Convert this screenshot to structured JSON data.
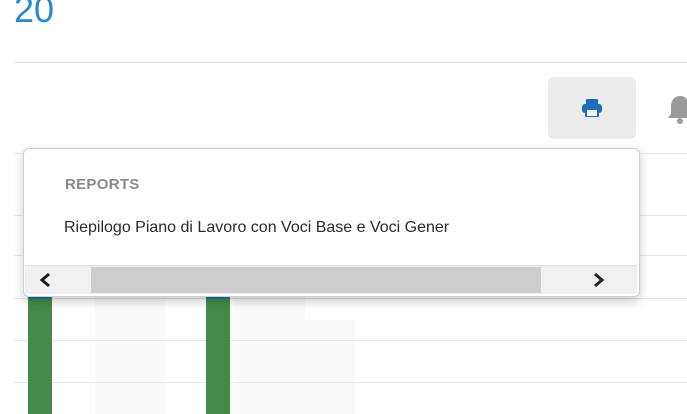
{
  "header": {
    "page_number": "20"
  },
  "toolbar": {
    "print_icon": "printer-icon",
    "bell_icon": "bell-icon",
    "accent_color": "#2c87c7"
  },
  "dropdown": {
    "heading": "REPORTS",
    "items": [
      {
        "label": "Riepilogo Piano di Lavoro con Voci Base e Voci Gener"
      }
    ],
    "scroll_left_icon": "chevron-left-icon",
    "scroll_right_icon": "chevron-right-icon"
  },
  "chart": {
    "bar_color": "#458a48",
    "bar_top_color": "#1f6fa8"
  }
}
